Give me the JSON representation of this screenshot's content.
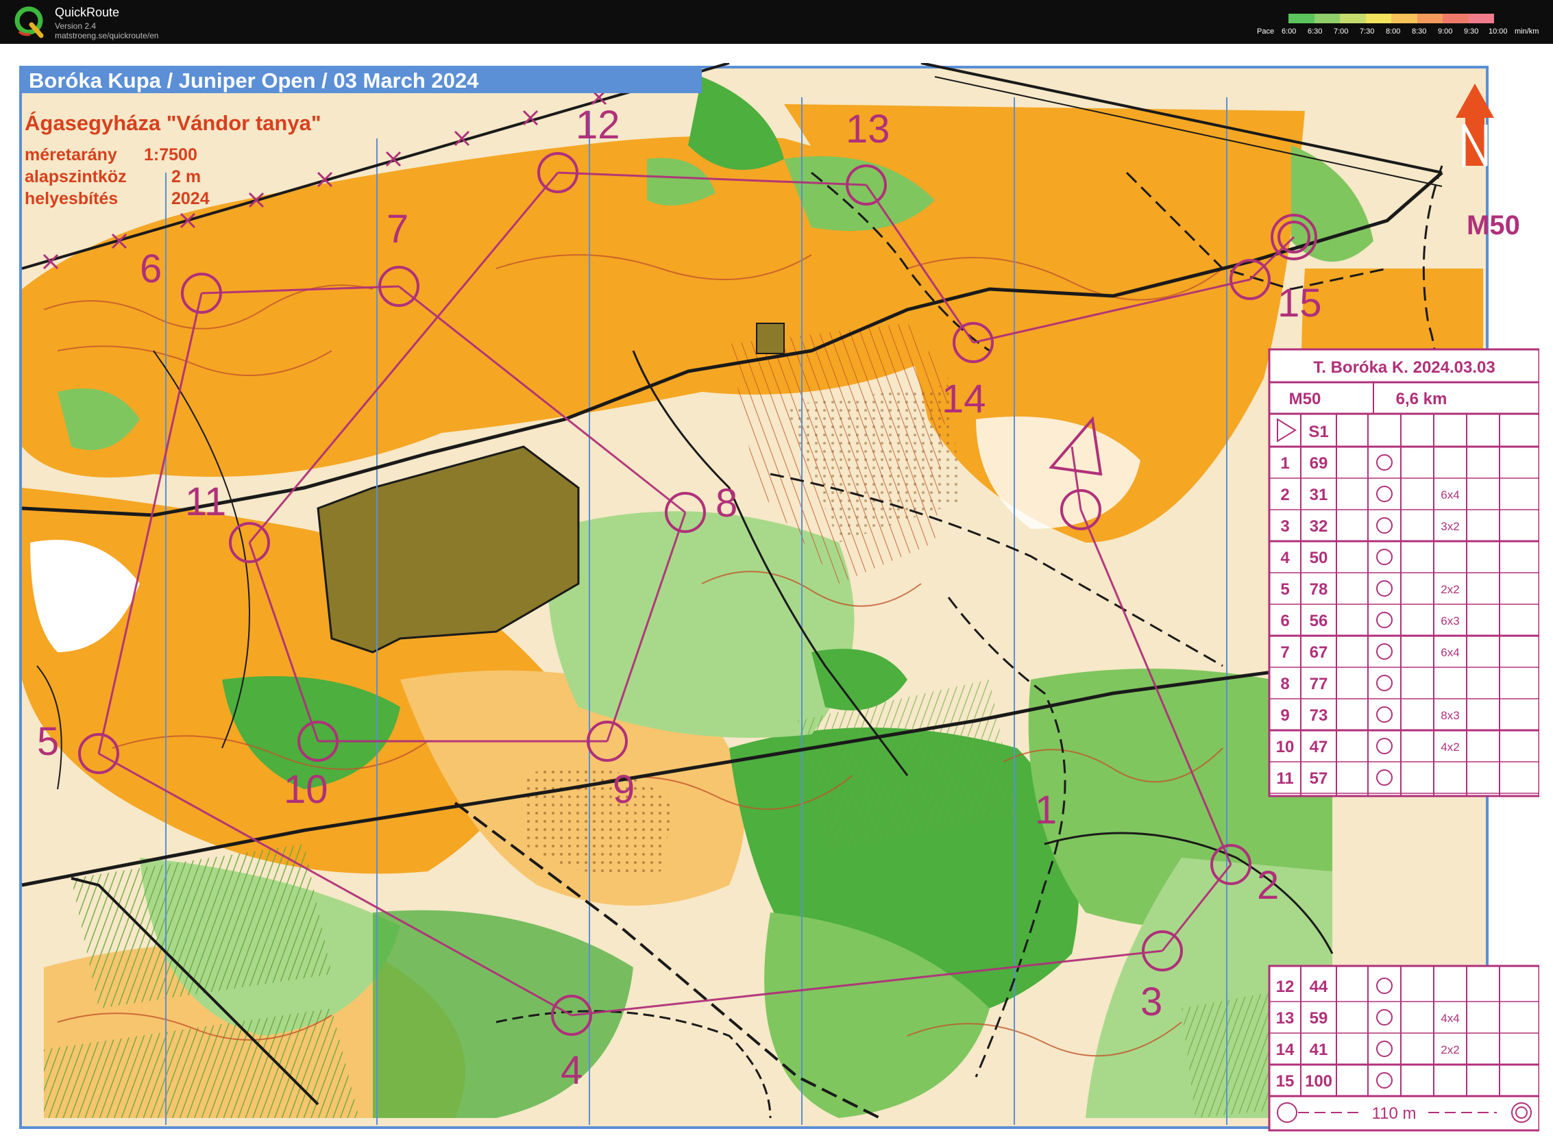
{
  "app": {
    "name": "QuickRoute",
    "version": "Version 2.4",
    "url": "matstroeng.se/quickroute/en"
  },
  "pace_legend": {
    "label": "Pace",
    "ticks": [
      "6:00",
      "6:30",
      "7:00",
      "7:30",
      "8:00",
      "8:30",
      "9:00",
      "9:30",
      "10:00"
    ],
    "unit": "min/km",
    "colors": [
      "#5cc45c",
      "#8fd06a",
      "#c6dc6e",
      "#f2e35c",
      "#f6c25a",
      "#f39a5c",
      "#ef7a6a",
      "#f07c8c"
    ]
  },
  "map": {
    "title": "Boróka Kupa / Juniper Open / 03 March 2024",
    "area_name": "Ágasegyháza \"Vándor tanya\"",
    "scale_label": "méretarány",
    "scale": "1:7500",
    "contour_label": "alapszintköz",
    "contour": "2 m",
    "updated_label": "helyesbítés",
    "updated": "2024",
    "category": "M50",
    "colors": {
      "orange": "#f5a623",
      "pale_orange": "#f7c56e",
      "green": "#4caf3e",
      "light_green": "#a8d98a",
      "olive": "#8a7a2a",
      "purple": "#b0307a",
      "contour": "#c2552a",
      "north": "#e8501e",
      "frame_blue": "#5b8fd6"
    }
  },
  "course_controls": [
    {
      "label": "1"
    },
    {
      "label": "2"
    },
    {
      "label": "3"
    },
    {
      "label": "4"
    },
    {
      "label": "5"
    },
    {
      "label": "6"
    },
    {
      "label": "7"
    },
    {
      "label": "8"
    },
    {
      "label": "9"
    },
    {
      "label": "10"
    },
    {
      "label": "11"
    },
    {
      "label": "12"
    },
    {
      "label": "13"
    },
    {
      "label": "14"
    },
    {
      "label": "15"
    }
  ],
  "description_sheet": {
    "header": "T. Boróka K. 2024.03.03",
    "category": "M50",
    "length": "6,6 km",
    "start_code": "S1",
    "rows": [
      {
        "no": "1",
        "code": "69",
        "dim": ""
      },
      {
        "no": "2",
        "code": "31",
        "dim": "6x4"
      },
      {
        "no": "3",
        "code": "32",
        "dim": "3x2"
      },
      {
        "no": "4",
        "code": "50",
        "dim": ""
      },
      {
        "no": "5",
        "code": "78",
        "dim": "2x2"
      },
      {
        "no": "6",
        "code": "56",
        "dim": "6x3"
      },
      {
        "no": "7",
        "code": "67",
        "dim": "6x4"
      },
      {
        "no": "8",
        "code": "77",
        "dim": ""
      },
      {
        "no": "9",
        "code": "73",
        "dim": "8x3"
      },
      {
        "no": "10",
        "code": "47",
        "dim": "4x2"
      },
      {
        "no": "11",
        "code": "57",
        "dim": ""
      }
    ],
    "rows2": [
      {
        "no": "12",
        "code": "44",
        "dim": ""
      },
      {
        "no": "13",
        "code": "59",
        "dim": "4x4"
      },
      {
        "no": "14",
        "code": "41",
        "dim": "2x2"
      },
      {
        "no": "15",
        "code": "100",
        "dim": ""
      }
    ],
    "finish": "110 m"
  }
}
